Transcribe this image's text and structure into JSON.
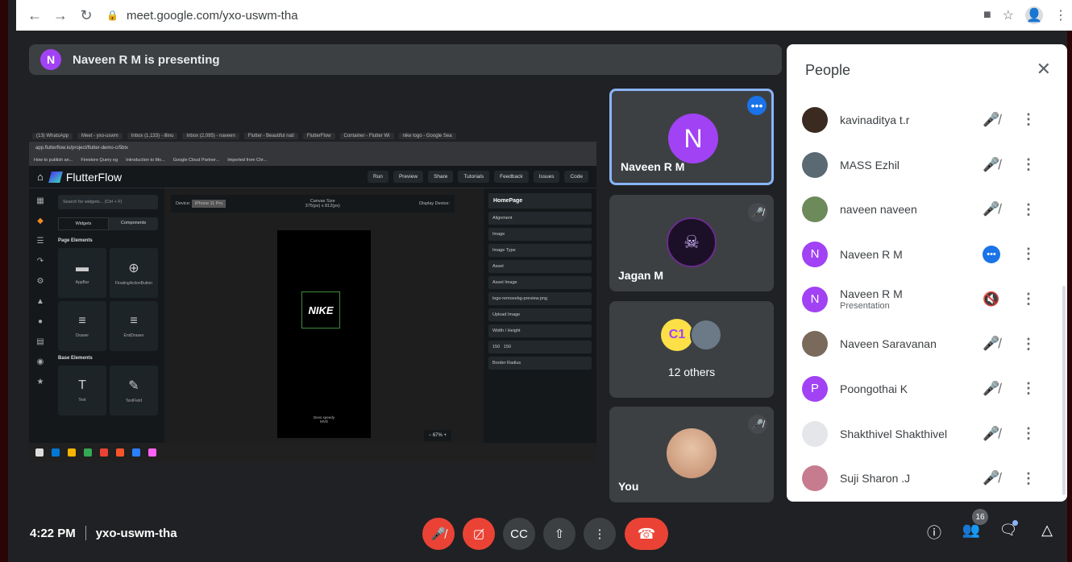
{
  "browser": {
    "url": "meet.google.com/yxo-uswm-tha"
  },
  "banner": {
    "avatar_letter": "N",
    "text": "Naveen R M is presenting"
  },
  "presentation": {
    "tabs": [
      "(13) WhatsApp",
      "Meet - yxo-uswm",
      "Inbox (1,133) - illinu",
      "Inbox (2,095) - naveen",
      "Flutter - Beautiful nati",
      "FlutterFlow",
      "Container - Flutter Wi",
      "nike logo - Google Sea"
    ],
    "url": "app.flutterflow.io/project/flutter-demo-cr5btx",
    "bookmarks": [
      "How to publish an...",
      "Firestore Query eg",
      "Introduction to Mo...",
      "Google Cloud Partner...",
      "Imported from Chr..."
    ],
    "app_name": "FlutterFlow",
    "toolbar": [
      "Run",
      "Preview",
      "Share",
      "Tutorials",
      "Feedback",
      "Issues",
      "Code"
    ],
    "search_placeholder": "Search for widgets... (Ctrl + F)",
    "widgets_tab": "Widgets",
    "components_tab": "Components",
    "page_elements": "Page Elements",
    "base_elements": "Base Elements",
    "widgets": [
      "AppBar",
      "FloatingActionButton",
      "Drawer",
      "EndDrawer",
      "Text",
      "TextField"
    ],
    "device_label": "Device:",
    "device_value": "iPhone 11 Pro",
    "canvas_size_label": "Canvas Size",
    "canvas_size_value": "375(px) x 812(px)",
    "display_device": "Display Device:",
    "logo_text": "NIKE",
    "caption_line1": "Devs speedy",
    "caption_line2": "MVD",
    "zoom": "67%",
    "props_head": "HomePage",
    "props": [
      "Alignment",
      "Image",
      "Image Type",
      "Asset",
      "Asset Image",
      "logo-removebg-preview.png",
      "Upload Image",
      "Width",
      "Height",
      "150",
      "150",
      "Border Radius"
    ]
  },
  "tiles": {
    "presenter": {
      "letter": "N",
      "name": "Naveen R M"
    },
    "jagan": {
      "name": "Jagan M"
    },
    "others": {
      "initials": "C1",
      "label": "12 others"
    },
    "you": {
      "name": "You"
    }
  },
  "people": {
    "title": "People",
    "list": [
      {
        "name": "kavinaditya t.r",
        "sub": "",
        "avatar": "",
        "avatar_color": "#3b2a1f"
      },
      {
        "name": "MASS Ezhil",
        "sub": "",
        "avatar": "",
        "avatar_color": "#5b6a72"
      },
      {
        "name": "naveen naveen",
        "sub": "",
        "avatar": "",
        "avatar_color": "#6d8a5a"
      },
      {
        "name": "Naveen R M",
        "sub": "",
        "avatar": "N",
        "avatar_color": "#a142f4"
      },
      {
        "name": "Naveen R M",
        "sub": "Presentation",
        "avatar": "N",
        "avatar_color": "#a142f4"
      },
      {
        "name": "Naveen Saravanan",
        "sub": "",
        "avatar": "",
        "avatar_color": "#7a6a5c"
      },
      {
        "name": "Poongothai K",
        "sub": "",
        "avatar": "P",
        "avatar_color": "#a142f4"
      },
      {
        "name": "Shakthivel Shakthivel",
        "sub": "",
        "avatar": "",
        "avatar_color": "#e4e6ea"
      },
      {
        "name": "Suji Sharon .J",
        "sub": "",
        "avatar": "",
        "avatar_color": "#c77b8f"
      }
    ]
  },
  "bottom": {
    "time": "4:22 PM",
    "meeting_code": "yxo-uswm-tha",
    "participant_count": "16"
  },
  "colors": {
    "accent": "#1a73e8",
    "danger": "#ea4335",
    "avatar_purple": "#a142f4",
    "tile_bg": "#3c4043"
  }
}
